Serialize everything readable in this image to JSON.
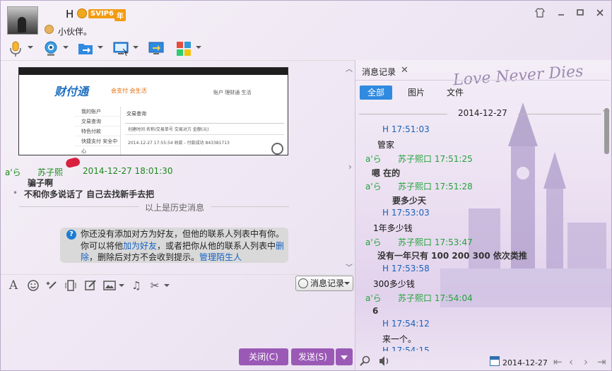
{
  "window": {
    "nickname": "H",
    "svip": "SVIP6",
    "year_badge": "年",
    "signature": "小伙伴。",
    "controls": {
      "skin": "👕",
      "min": "—",
      "max": "□",
      "close": "✕"
    },
    "toolbar_icons": [
      "microphone-icon",
      "video-icon",
      "file-transfer-icon",
      "remote-desktop-icon",
      "screen-share-icon",
      "apps-icon"
    ]
  },
  "chat": {
    "screenshot": {
      "logo": "财付通",
      "tagline": "会支付 会生活",
      "nav": "账户    理财通    生活",
      "side": [
        "我的账户",
        "交易查询",
        "特色付款",
        "快捷支付   安全中心"
      ],
      "title": "交易查询",
      "table_header": "创建时间    名称/交易单号    交易对方    金额(元)",
      "table_row": "2014-12-27 17:55:54    收款 - 付款成功    843381713"
    },
    "messages": [
      {
        "sender": "a'ら",
        "name": "苏子熙",
        "time": "2014-12-27 18:01:30",
        "lines": [
          "骗子啊",
          "不和你多说话了  自己去找新手去把"
        ]
      }
    ],
    "history_label": "以上是历史消息",
    "notice": {
      "part1": "你还没有添加对方为好友，但他的联系人列表中有你。你可以将他",
      "link1": "加为好友",
      "part2": "，或者把你从他的联系人列表中",
      "link2": "删除",
      "part3": "，删除后对方不会收到提示。",
      "link3": "管理陌生人"
    }
  },
  "input_toolbar": {
    "icons": [
      "font-icon",
      "emoji-icon",
      "magic-icon",
      "vibrate-icon",
      "doodle-icon",
      "image-icon",
      "music-icon",
      "screenshot-icon"
    ],
    "history_button": "消息记录"
  },
  "buttons": {
    "close": "关闭(C)",
    "send": "发送(S)"
  },
  "history_pane": {
    "tab": "消息记录",
    "filters": [
      "全部",
      "图片",
      "文件"
    ],
    "date": "2014-12-27",
    "decor_text": "Love Never Dies",
    "entries": [
      {
        "type": "me",
        "header": "H 17:51:03",
        "text": "管家"
      },
      {
        "type": "peer",
        "sender": "a'ら",
        "header": "苏子熙口 17:51:25",
        "text": "嗯  在的"
      },
      {
        "type": "peer",
        "sender": "a'ら",
        "header": "苏子熙口 17:51:28",
        "text": "要多少天"
      },
      {
        "type": "me",
        "header": "H 17:53:03",
        "text": "1年多少钱"
      },
      {
        "type": "peer",
        "sender": "a'ら",
        "header": "苏子熙口 17:53:47",
        "text": "没有一年只有  100  200  300    依次类推"
      },
      {
        "type": "me",
        "header": "H 17:53:58",
        "text": "300多少钱"
      },
      {
        "type": "peer",
        "sender": "a'ら",
        "header": "苏子熙口 17:54:04",
        "text": "6"
      },
      {
        "type": "me",
        "header": "H 17:54:12",
        "text": "来一个。"
      },
      {
        "type": "me",
        "header": "H 17:54:15",
        "text": ""
      }
    ],
    "footer_date": "2014-12-27"
  }
}
